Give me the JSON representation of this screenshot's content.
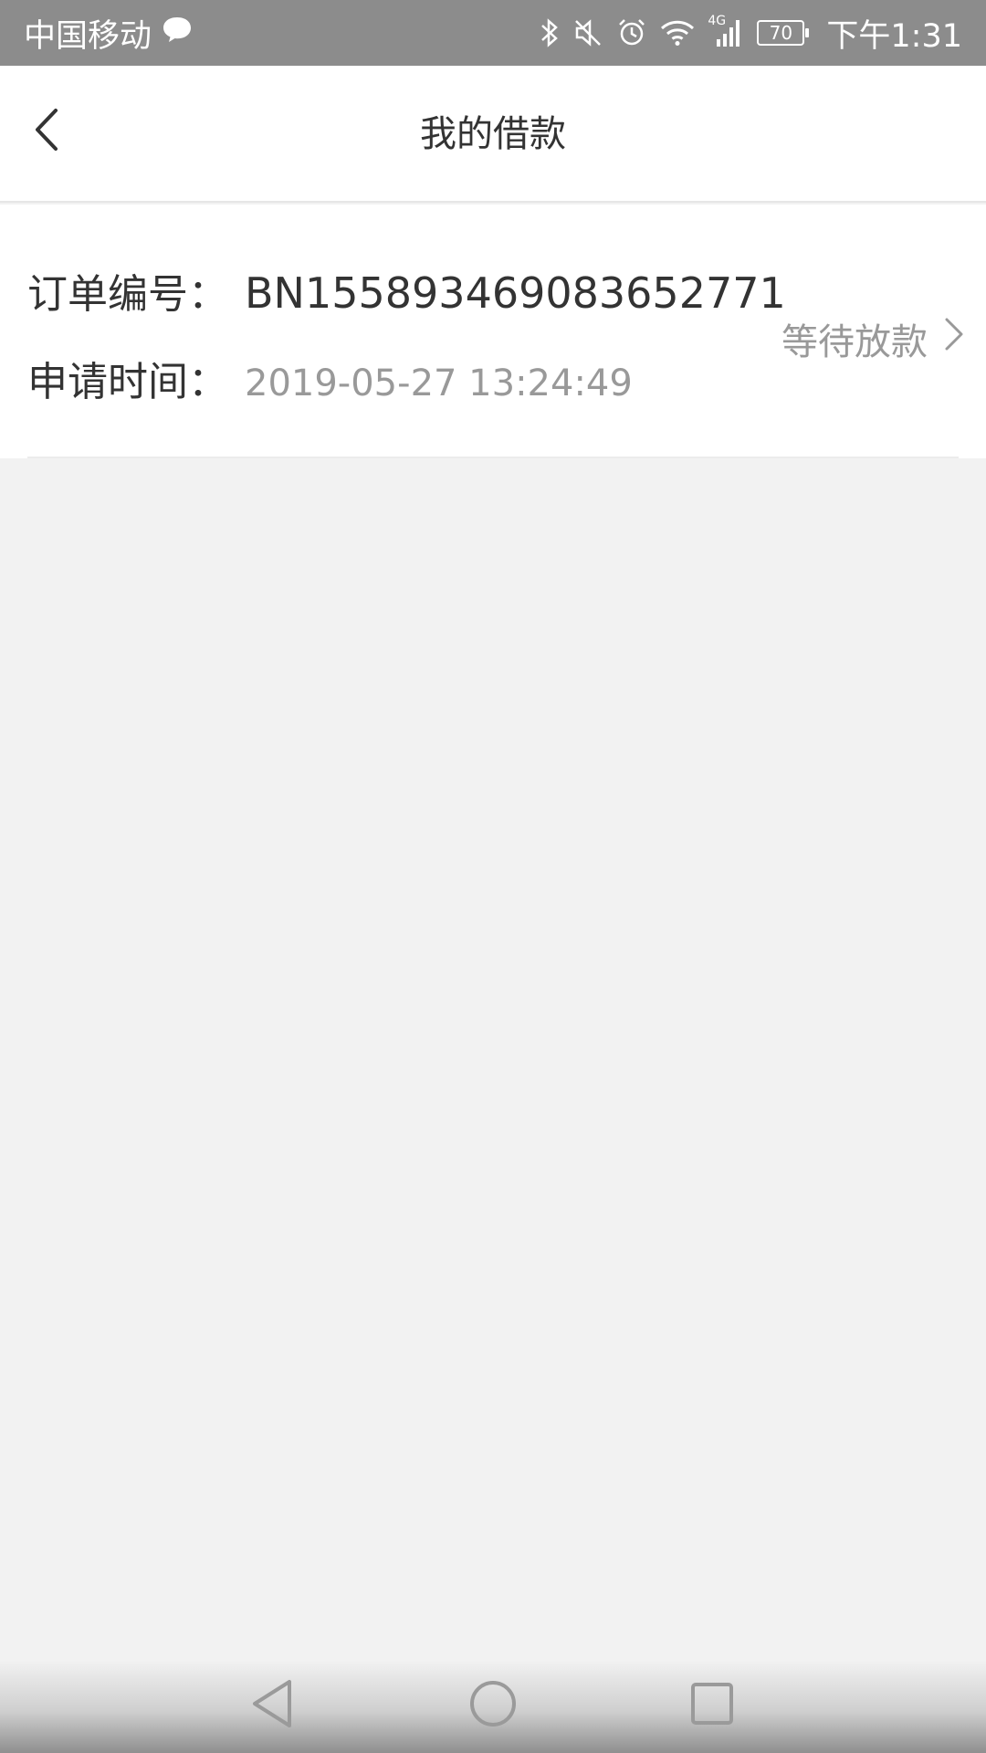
{
  "status_bar": {
    "carrier": "中国移动",
    "network": "4G",
    "battery": "70",
    "time": "下午1:31",
    "icons": [
      "message-icon",
      "bluetooth-icon",
      "mute-icon",
      "alarm-icon",
      "wifi-icon",
      "signal-icon",
      "battery-icon"
    ]
  },
  "header": {
    "title": "我的借款",
    "back_icon": "back-arrow-icon"
  },
  "order": {
    "order_no_label": "订单编号：",
    "order_no": "BN155893469083652771",
    "apply_time_label": "申请时间：",
    "apply_time": "2019-05-27 13:24:49",
    "status": "等待放款",
    "status_icon": "chevron-right-icon"
  },
  "system_nav": {
    "buttons": [
      "back-triangle-icon",
      "home-circle-icon",
      "recents-square-icon"
    ]
  },
  "colors": {
    "status_bar_bg": "#8c8c8c",
    "page_bg": "#f2f2f2",
    "text_primary": "#333333",
    "text_secondary": "#999999"
  }
}
